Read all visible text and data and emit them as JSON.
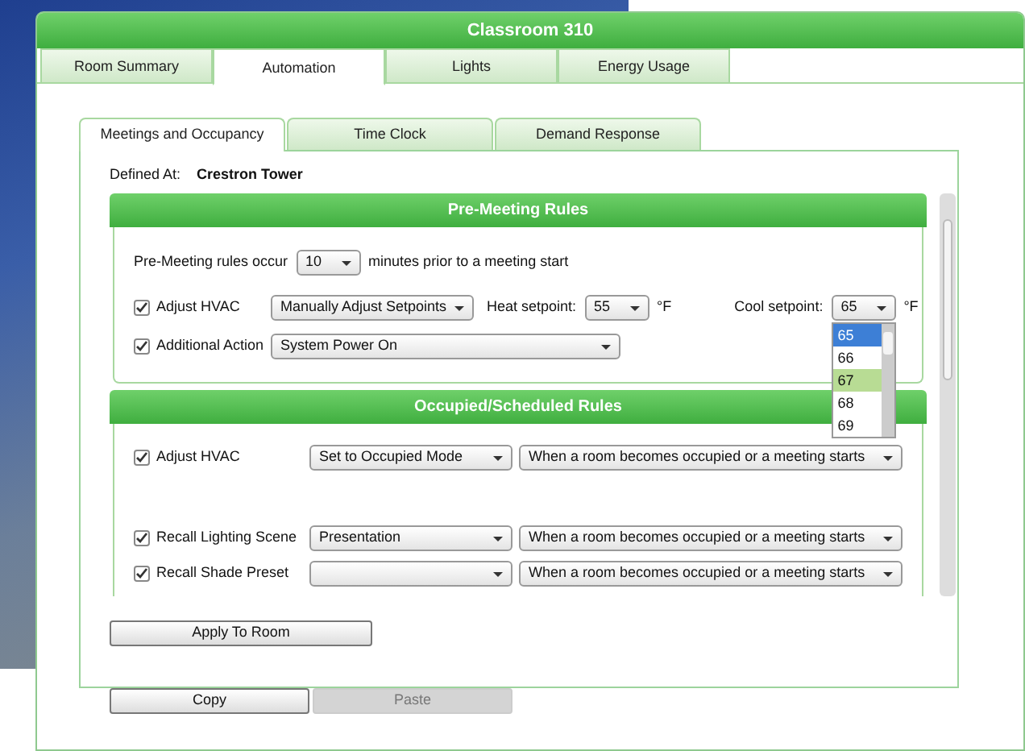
{
  "window": {
    "title": "Classroom 310"
  },
  "tabs": [
    {
      "label": "Room Summary",
      "selected": false
    },
    {
      "label": "Automation",
      "selected": true
    },
    {
      "label": "Lights",
      "selected": false
    },
    {
      "label": "Energy Usage",
      "selected": false
    }
  ],
  "subtabs": [
    {
      "label": "Meetings and Occupancy",
      "selected": true
    },
    {
      "label": "Time Clock",
      "selected": false
    },
    {
      "label": "Demand Response",
      "selected": false
    }
  ],
  "defined_at": {
    "label": "Defined At:",
    "value": "Crestron Tower"
  },
  "pre_meeting": {
    "title": "Pre-Meeting Rules",
    "lead_label": "Pre-Meeting rules occur",
    "minutes": "10",
    "lead_suffix": "minutes prior to a meeting start",
    "hvac": {
      "label": "Adjust HVAC",
      "checked": true,
      "mode": "Manually Adjust Setpoints",
      "heat_label": "Heat setpoint:",
      "heat": "55",
      "heat_unit": "°F",
      "cool_label": "Cool setpoint:",
      "cool": "65",
      "cool_unit": "°F",
      "cool_options": [
        {
          "label": "65",
          "selected": true,
          "hovered": false
        },
        {
          "label": "66",
          "selected": false,
          "hovered": false
        },
        {
          "label": "67",
          "selected": false,
          "hovered": true
        },
        {
          "label": "68",
          "selected": false,
          "hovered": false
        },
        {
          "label": "69",
          "selected": false,
          "hovered": false
        }
      ]
    },
    "action": {
      "label": "Additional Action",
      "checked": true,
      "value": "System Power On"
    }
  },
  "occupied": {
    "title": "Occupied/Scheduled Rules",
    "rules": [
      {
        "label": "Adjust HVAC",
        "checked": true,
        "value": "Set to Occupied Mode",
        "trigger": "When a room becomes occupied or a meeting starts"
      },
      {
        "label": "Recall Lighting Scene",
        "checked": true,
        "value": "Presentation",
        "trigger": "When a room becomes occupied or a meeting starts"
      },
      {
        "label": "Recall Shade Preset",
        "checked": true,
        "trigger": "When a room becomes occupied or a meeting starts"
      }
    ]
  },
  "apply_button": {
    "label": "Apply To Room"
  },
  "buttons": [
    {
      "label": "Copy",
      "disabled": false
    },
    {
      "label": "Paste",
      "disabled": true
    }
  ]
}
